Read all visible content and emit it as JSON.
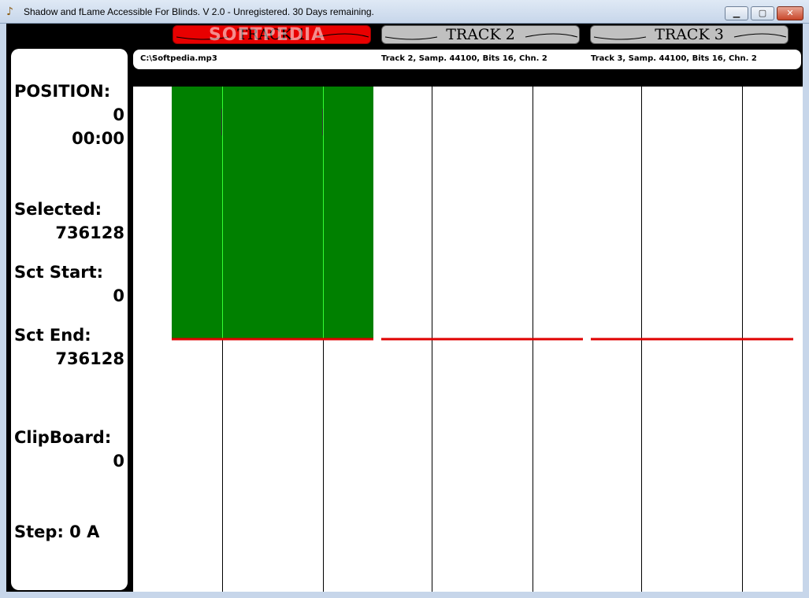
{
  "window": {
    "title": "Shadow and fLame Accessible For Blinds. V 2.0  - Unregistered. 30 Days remaining.",
    "app_icon": "harp-icon",
    "minimize_glyph": "▁",
    "maximize_glyph": "▢",
    "close_glyph": "✕"
  },
  "tracks": [
    {
      "label": "TRACK 1",
      "active": true,
      "info": "C:\\Softpedia.mp3"
    },
    {
      "label": "TRACK 2",
      "active": false,
      "info": "Track 2, Samp. 44100, Bits 16, Chn. 2"
    },
    {
      "label": "TRACK 3",
      "active": false,
      "info": "Track 3, Samp. 44100, Bits 16, Chn. 2"
    }
  ],
  "watermark": "SOFTPEDIA",
  "status": {
    "position_label": "POSITION:",
    "position_samples": "0",
    "position_time": "00:00",
    "selected_label": "Selected:",
    "selected_value": "736128",
    "sct_start_label": "Sct Start:",
    "sct_start_value": "0",
    "sct_end_label": "Sct End:",
    "sct_end_value": "736128",
    "clipboard_label": "ClipBoard:",
    "clipboard_value": "0",
    "step_label": "Step: 0 A"
  },
  "colors": {
    "active_tab": "#e80000",
    "inactive_tab": "#c0c0c0",
    "selection": "#008000",
    "waveform_line": "#e00000",
    "marker_line": "#33ff33",
    "grid_line": "#000000"
  }
}
